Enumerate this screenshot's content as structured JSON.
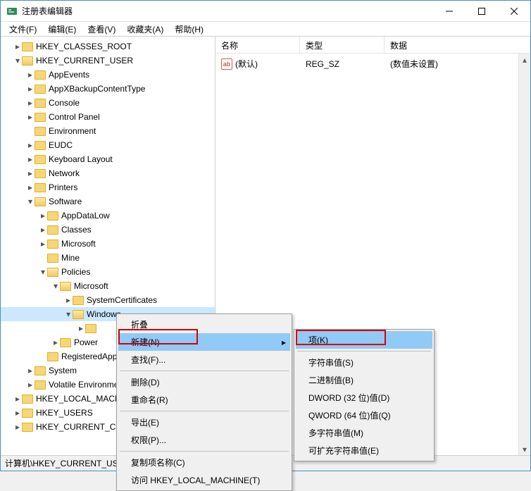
{
  "window": {
    "title": "注册表编辑器"
  },
  "menubar": [
    "文件(F)",
    "编辑(E)",
    "查看(V)",
    "收藏夹(A)",
    "帮助(H)"
  ],
  "tree": {
    "r0": "HKEY_CLASSES_ROOT",
    "r1": "HKEY_CURRENT_USER",
    "r2": "AppEvents",
    "r3": "AppXBackupContentType",
    "r4": "Console",
    "r5": "Control Panel",
    "r6": "Environment",
    "r7": "EUDC",
    "r8": "Keyboard Layout",
    "r9": "Network",
    "r10": "Printers",
    "r11": "Software",
    "r12": "AppDataLow",
    "r13": "Classes",
    "r14": "Microsoft",
    "r15": "Mine",
    "r16": "Policies",
    "r17": "Microsoft",
    "r18": "SystemCertificates",
    "r19": "Windows",
    "r20": "Power",
    "r21": "RegisteredApplications",
    "r22": "System",
    "r23": "Volatile Environment",
    "r24": "HKEY_LOCAL_MACHINE",
    "r25": "HKEY_USERS",
    "r26": "HKEY_CURRENT_CONFIG"
  },
  "list": {
    "cols": {
      "name": "名称",
      "type": "类型",
      "data": "数据"
    },
    "row0": {
      "name": "(默认)",
      "type": "REG_SZ",
      "data": "(数值未设置)",
      "iconText": "ab"
    }
  },
  "context1": {
    "collapse": "折叠",
    "new": "新建(N)",
    "find": "查找(F)...",
    "delete": "删除(D)",
    "rename": "重命名(R)",
    "export": "导出(E)",
    "permissions": "权限(P)...",
    "copykey": "复制项名称(C)",
    "goto": "访问 HKEY_LOCAL_MACHINE(T)"
  },
  "context2": {
    "key": "项(K)",
    "string": "字符串值(S)",
    "binary": "二进制值(B)",
    "dword": "DWORD (32 位)值(D)",
    "qword": "QWORD (64 位)值(Q)",
    "multi": "多字符串值(M)",
    "expand": "可扩充字符串值(E)"
  },
  "status": "计算机\\HKEY_CURRENT_USER\\Software\\Policies\\Microsoft\\Windows"
}
